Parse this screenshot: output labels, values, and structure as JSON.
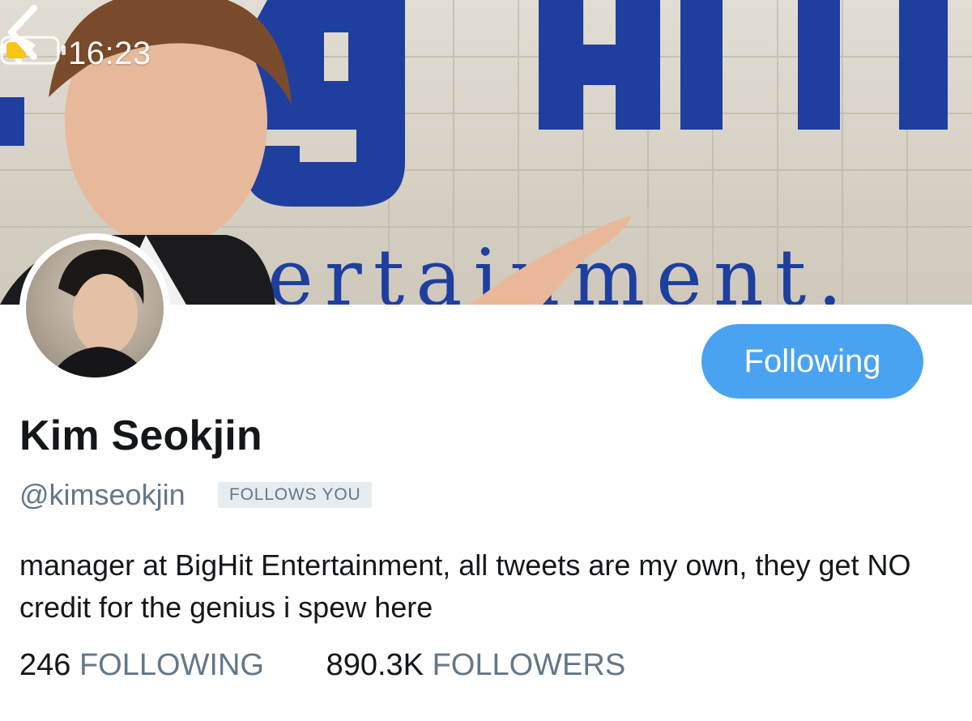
{
  "status_bar": {
    "time": "16:23",
    "icons": [
      "location-arrow-icon",
      "signal-icon",
      "wifi-icon",
      "battery-icon"
    ],
    "battery_color": "#f5c518"
  },
  "header": {
    "back_icon": "chevron-left-icon",
    "banner_text": "ertainment"
  },
  "profile": {
    "name": "Kim Seokjin",
    "handle": "@kimseokjin",
    "follows_you_badge": "FOLLOWS YOU",
    "follow_button_label": "Following",
    "bio": "manager at BigHit Entertainment, all tweets are my own, they get NO credit for the genius i spew here"
  },
  "stats": {
    "following_count": "246",
    "following_label": "FOLLOWING",
    "followers_count": "890.3K",
    "followers_label": "FOLLOWERS"
  },
  "colors": {
    "accent": "#4aa3f0",
    "secondary_text": "#657786",
    "primary_text": "#14171a",
    "badge_bg": "#e6ecf0"
  }
}
